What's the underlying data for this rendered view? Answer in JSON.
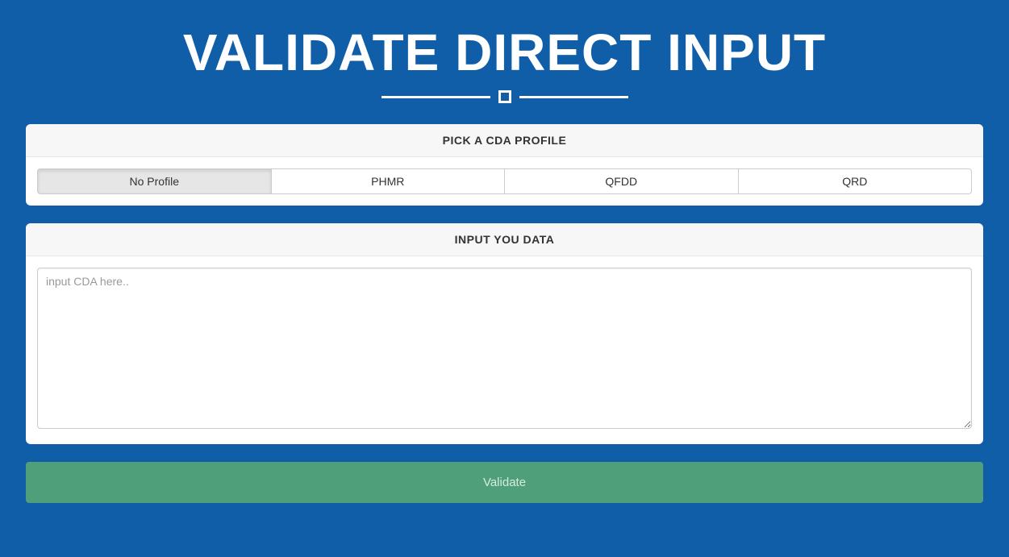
{
  "header": {
    "title": "VALIDATE DIRECT INPUT"
  },
  "profilePanel": {
    "header": "PICK A CDA PROFILE",
    "options": [
      {
        "label": "No Profile",
        "active": true
      },
      {
        "label": "PHMR",
        "active": false
      },
      {
        "label": "QFDD",
        "active": false
      },
      {
        "label": "QRD",
        "active": false
      }
    ]
  },
  "inputPanel": {
    "header": "INPUT YOU DATA",
    "placeholder": "input CDA here.."
  },
  "validateButton": {
    "label": "Validate"
  }
}
